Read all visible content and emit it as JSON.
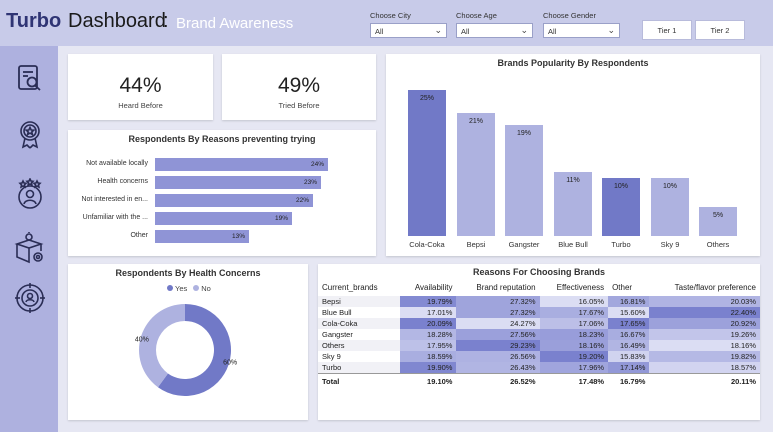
{
  "header": {
    "brand": "Turbo",
    "title": "Dashboard",
    "colon": ":",
    "subtitle": "Brand Awareness",
    "filters": [
      {
        "label": "Choose City",
        "value": "All"
      },
      {
        "label": "Choose Age",
        "value": "All"
      },
      {
        "label": "Choose Gender",
        "value": "All"
      }
    ],
    "tier_buttons": [
      "Tier 1",
      "Tier 2"
    ]
  },
  "sidebar": {
    "icons": [
      "report-search-icon",
      "award-badge-icon",
      "people-rating-icon",
      "product-box-icon",
      "target-icon"
    ]
  },
  "kpis": [
    {
      "value": "44%",
      "label": "Heard Before"
    },
    {
      "value": "49%",
      "label": "Tried Before"
    }
  ],
  "colors": {
    "dark": "#7179c7",
    "light": "#aeb2e0",
    "bar": "#8f94d6"
  },
  "reasons_chart": {
    "title": "Respondents By Reasons preventing trying",
    "items": [
      {
        "label": "Not available locally",
        "value": 24,
        "text": "24%"
      },
      {
        "label": "Health concerns",
        "value": 23,
        "text": "23%"
      },
      {
        "label": "Not interested in en...",
        "value": 22,
        "text": "22%"
      },
      {
        "label": "Unfamiliar with the ...",
        "value": 19,
        "text": "19%"
      },
      {
        "label": "Other",
        "value": 13,
        "text": "13%"
      }
    ]
  },
  "popularity_chart": {
    "title": "Brands Popularity By Respondents",
    "items": [
      {
        "label": "Cola-Coka",
        "value": 25,
        "text": "25%",
        "shade": "dark"
      },
      {
        "label": "Bepsi",
        "value": 21,
        "text": "21%",
        "shade": "light"
      },
      {
        "label": "Gangster",
        "value": 19,
        "text": "19%",
        "shade": "light"
      },
      {
        "label": "Blue Bull",
        "value": 11,
        "text": "11%",
        "shade": "light"
      },
      {
        "label": "Turbo",
        "value": 10,
        "text": "10%",
        "shade": "dark"
      },
      {
        "label": "Sky 9",
        "value": 10,
        "text": "10%",
        "shade": "light"
      },
      {
        "label": "Others",
        "value": 5,
        "text": "5%",
        "shade": "light"
      }
    ]
  },
  "health_chart": {
    "title": "Respondents By Health Concerns",
    "legend": [
      {
        "label": "Yes",
        "color": "#7179c7"
      },
      {
        "label": "No",
        "color": "#aeb2e0"
      }
    ],
    "slices": [
      {
        "label": "Yes",
        "value": 60,
        "text": "60%"
      },
      {
        "label": "No",
        "value": 40,
        "text": "40%"
      }
    ]
  },
  "reasons_table": {
    "title": "Reasons For Choosing Brands",
    "columns": [
      "Current_brands",
      "Availability",
      "Brand reputation",
      "Effectiveness",
      "Other",
      "Taste/flavor preference"
    ],
    "rows": [
      {
        "brand": "Bepsi",
        "values": [
          "19.79%",
          "27.32%",
          "16.05%",
          "16.81%",
          "20.03%"
        ]
      },
      {
        "brand": "Blue Bull",
        "values": [
          "17.01%",
          "27.32%",
          "17.67%",
          "15.60%",
          "22.40%"
        ]
      },
      {
        "brand": "Cola-Coka",
        "values": [
          "20.09%",
          "24.27%",
          "17.06%",
          "17.65%",
          "20.92%"
        ]
      },
      {
        "brand": "Gangster",
        "values": [
          "18.28%",
          "27.56%",
          "18.23%",
          "16.67%",
          "19.26%"
        ]
      },
      {
        "brand": "Others",
        "values": [
          "17.95%",
          "29.23%",
          "18.16%",
          "16.49%",
          "18.16%"
        ]
      },
      {
        "brand": "Sky 9",
        "values": [
          "18.59%",
          "26.56%",
          "19.20%",
          "15.83%",
          "19.82%"
        ]
      },
      {
        "brand": "Turbo",
        "values": [
          "19.90%",
          "26.43%",
          "17.96%",
          "17.14%",
          "18.57%"
        ]
      }
    ],
    "total": {
      "brand": "Total",
      "values": [
        "19.10%",
        "26.52%",
        "17.48%",
        "16.79%",
        "20.11%"
      ]
    }
  }
}
